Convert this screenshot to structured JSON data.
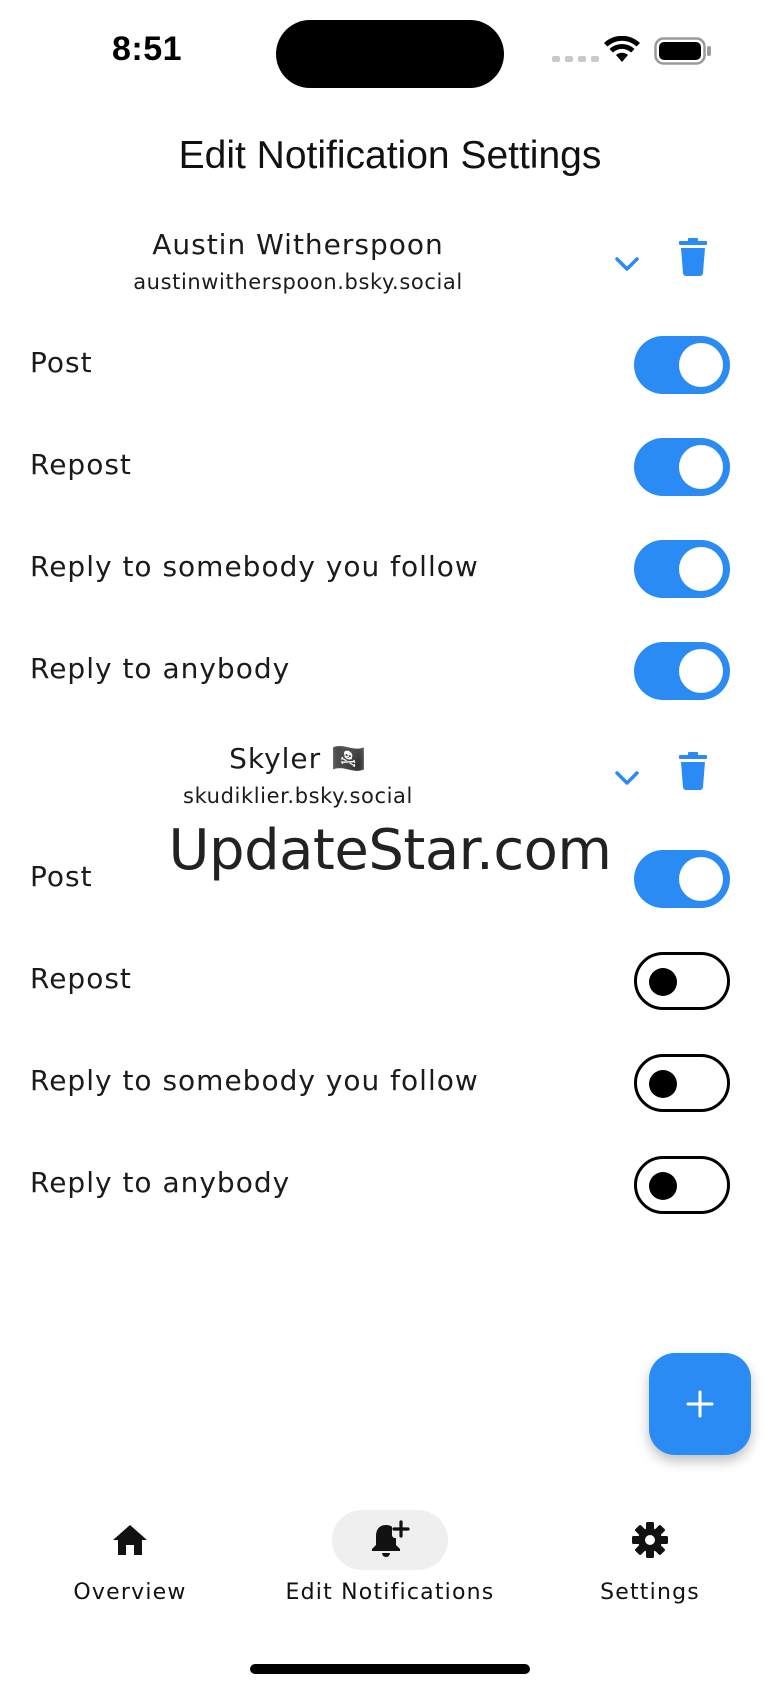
{
  "status_bar": {
    "time": "8:51",
    "icons": [
      "cellular-signal-icon",
      "wifi-icon",
      "battery-icon"
    ]
  },
  "page": {
    "title": "Edit Notification Settings"
  },
  "colors": {
    "accent": "#2b8bf5",
    "toggle_off_border": "#000000"
  },
  "accounts": [
    {
      "name": "Austin Witherspoon",
      "handle": "austinwitherspoon.bsky.social",
      "settings": [
        {
          "label": "Post",
          "enabled": true
        },
        {
          "label": "Repost",
          "enabled": true
        },
        {
          "label": "Reply to somebody you follow",
          "enabled": true
        },
        {
          "label": "Reply to anybody",
          "enabled": true
        }
      ]
    },
    {
      "name": "Skyler 🏴‍☠️",
      "handle": "skudiklier.bsky.social",
      "settings": [
        {
          "label": "Post",
          "enabled": true
        },
        {
          "label": "Repost",
          "enabled": false
        },
        {
          "label": "Reply to somebody you follow",
          "enabled": false
        },
        {
          "label": "Reply to anybody",
          "enabled": false
        }
      ]
    }
  ],
  "watermark": "UpdateStar.com",
  "fab": {
    "icon": "plus-icon"
  },
  "bottom_nav": {
    "items": [
      {
        "label": "Overview",
        "icon": "home-icon",
        "active": false
      },
      {
        "label": "Edit Notifications",
        "icon": "bell-plus-icon",
        "active": true
      },
      {
        "label": "Settings",
        "icon": "gear-icon",
        "active": false
      }
    ]
  }
}
